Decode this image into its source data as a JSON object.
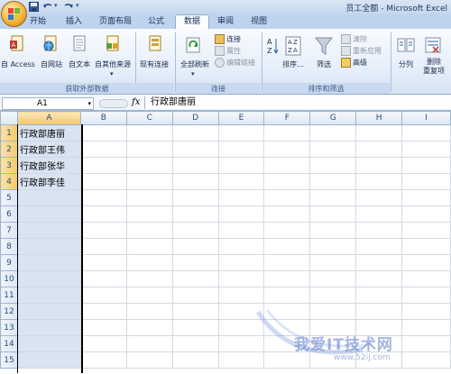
{
  "window": {
    "title": "员工全额 - Microsoft Excel"
  },
  "tabs": [
    {
      "label": "开始",
      "active": false
    },
    {
      "label": "插入",
      "active": false
    },
    {
      "label": "页面布局",
      "active": false
    },
    {
      "label": "公式",
      "active": false
    },
    {
      "label": "数据",
      "active": true
    },
    {
      "label": "审阅",
      "active": false
    },
    {
      "label": "视图",
      "active": false
    }
  ],
  "ribbon": {
    "external": {
      "label": "获取外部数据",
      "buttons": [
        "自 Access",
        "自网站",
        "自文本",
        "自其他来源",
        "现有连接"
      ]
    },
    "connections": {
      "label": "连接",
      "refresh": "全部刷新",
      "items": [
        {
          "label": "连接",
          "disabled": false
        },
        {
          "label": "属性",
          "disabled": true
        },
        {
          "label": "编辑链接",
          "disabled": true
        }
      ]
    },
    "sort_filter": {
      "label": "排序和筛选",
      "sort": "排序...",
      "filter": "筛选",
      "items": [
        {
          "label": "清除",
          "disabled": true
        },
        {
          "label": "重新应用",
          "disabled": true
        },
        {
          "label": "高级",
          "disabled": false
        }
      ]
    },
    "tools": {
      "split": "分列",
      "remove": "删除",
      "remove2": "重复项"
    }
  },
  "formula_bar": {
    "name_box": "A1",
    "fx": "fx",
    "value": "行政部唐丽"
  },
  "grid": {
    "columns": [
      "A",
      "B",
      "C",
      "D",
      "E",
      "F",
      "G",
      "H",
      "I"
    ],
    "rows": [
      "1",
      "2",
      "3",
      "4",
      "5",
      "6",
      "7",
      "8",
      "9",
      "10",
      "11",
      "12",
      "13",
      "14",
      "15"
    ],
    "cells": [
      "行政部唐丽",
      "行政部王伟",
      "行政部张华",
      "行政部李佳"
    ]
  },
  "watermark": {
    "text": "我爱IT技术网",
    "url": "www.52ij.com"
  },
  "colors": {
    "accent": "#f3b43c",
    "ribbon": "#dfe8f5",
    "header": "#dde6f3"
  }
}
